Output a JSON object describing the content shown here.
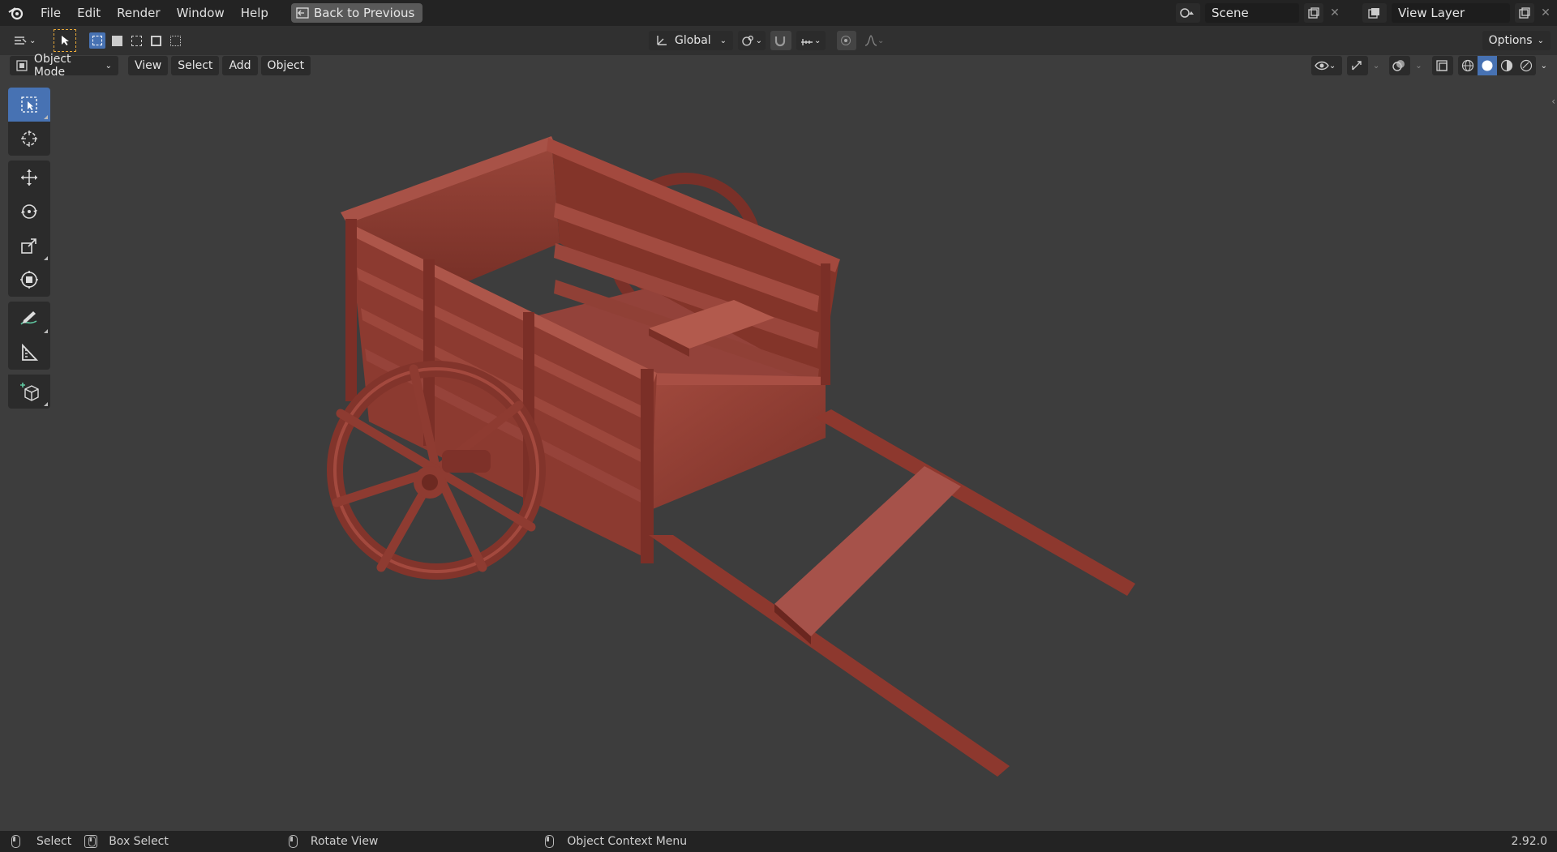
{
  "topbar": {
    "menus": [
      "File",
      "Edit",
      "Render",
      "Window",
      "Help"
    ],
    "back_button": "Back to Previous",
    "scene_name": "Scene",
    "view_layer_name": "View Layer"
  },
  "header": {
    "orientation": "Global",
    "options_label": "Options"
  },
  "viewport_header": {
    "mode": "Object Mode",
    "menus": [
      "View",
      "Select",
      "Add",
      "Object"
    ]
  },
  "toolbar": {
    "tools": [
      "select-box-icon",
      "cursor-icon",
      "move-icon",
      "rotate-icon",
      "scale-icon",
      "transform-icon",
      "annotate-icon",
      "measure-icon",
      "add-cube-icon"
    ],
    "active_tool": "select-box-icon"
  },
  "statusbar": {
    "select": "Select",
    "box_select": "Box Select",
    "rotate_view": "Rotate View",
    "context_menu": "Object Context Menu",
    "version": "2.92.0"
  },
  "colors": {
    "accent": "#4772b3",
    "model": "#8e3a30",
    "viewport_bg": "#3d3d3d"
  }
}
